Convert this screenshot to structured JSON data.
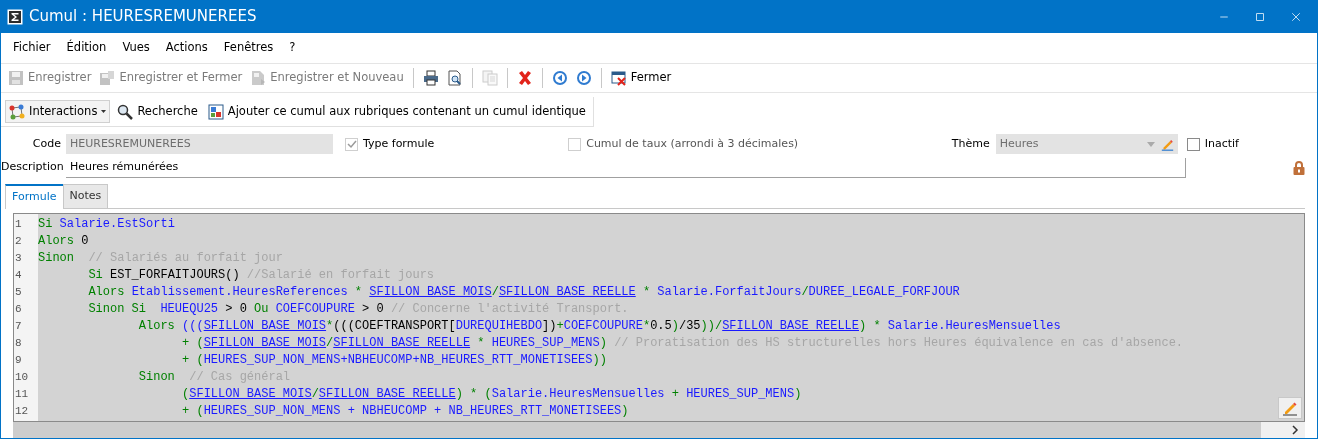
{
  "window": {
    "title": "Cumul : HEURESREMUNEREES"
  },
  "menu": [
    "Fichier",
    "Édition",
    "Vues",
    "Actions",
    "Fenêtres",
    "?"
  ],
  "toolbar": [
    {
      "kind": "button",
      "label": "Enregistrer",
      "disabled": true
    },
    {
      "kind": "button",
      "label": "Enregistrer et Fermer",
      "disabled": true
    },
    {
      "kind": "button",
      "label": "Enregistrer et Nouveau",
      "disabled": true
    },
    {
      "kind": "separator"
    },
    {
      "kind": "button",
      "disabled": false
    },
    {
      "kind": "button",
      "disabled": false
    },
    {
      "kind": "separator"
    },
    {
      "kind": "button",
      "disabled": true
    },
    {
      "kind": "separator"
    },
    {
      "kind": "button",
      "disabled": false
    },
    {
      "kind": "separator"
    },
    {
      "kind": "button",
      "disabled": false
    },
    {
      "kind": "button",
      "disabled": false
    },
    {
      "kind": "separator"
    },
    {
      "kind": "button",
      "label": "Fermer",
      "disabled": false
    }
  ],
  "toolbar2": [
    {
      "kind": "dropdown",
      "label": "Interactions"
    },
    {
      "kind": "button",
      "label": "Recherche"
    },
    {
      "kind": "button",
      "label": "Ajouter ce cumul aux rubriques contenant un cumul identique"
    }
  ],
  "form": {
    "code": {
      "label": "Code",
      "value": "HEURESREMUNEREES",
      "disabled": true
    },
    "type_formule": {
      "label": "Type formule",
      "checked": true,
      "disabled": true
    },
    "cumul_taux": {
      "label": "Cumul de taux (arrondi à 3 décimales)",
      "checked": false,
      "disabled": true
    },
    "theme": {
      "label": "Thème",
      "value": "Heures",
      "disabled": true
    },
    "inactif": {
      "label": "Inactif",
      "checked": false,
      "disabled": false
    },
    "description": {
      "label": "Description",
      "value": "Heures rémunérées"
    },
    "locked": true
  },
  "tabs": [
    {
      "label": "Formule",
      "selected": true
    },
    {
      "label": "Notes",
      "selected": false
    }
  ],
  "code_lines": [
    {
      "number": "1",
      "tokens": [
        {
          "kind": "kw",
          "text": "Si "
        },
        {
          "kind": "id",
          "text": "Salarie.EstSorti"
        }
      ]
    },
    {
      "number": "2",
      "tokens": [
        {
          "kind": "kw",
          "text": "Alors "
        },
        {
          "kind": "tx",
          "text": "0"
        }
      ]
    },
    {
      "number": "3",
      "tokens": [
        {
          "kind": "kw",
          "text": "Sinon "
        },
        {
          "kind": "cm",
          "text": " // Salariés au forfait jour"
        }
      ]
    },
    {
      "number": "4",
      "tokens": [
        {
          "kind": "kw",
          "text": "       Si "
        },
        {
          "kind": "tx",
          "text": "EST_FORFAITJOURS()"
        },
        {
          "kind": "cm",
          "text": " //Salarié en forfait jours"
        }
      ]
    },
    {
      "number": "5",
      "tokens": [
        {
          "kind": "kw",
          "text": "       Alors "
        },
        {
          "kind": "id",
          "text": "Etablissement.HeuresReferences"
        },
        {
          "kind": "op",
          "text": " * "
        },
        {
          "kind": "ln",
          "text": "SFILLON_BASE_MOIS"
        },
        {
          "kind": "op",
          "text": "/"
        },
        {
          "kind": "ln",
          "text": "SFILLON_BASE_REELLE"
        },
        {
          "kind": "op",
          "text": " * "
        },
        {
          "kind": "id",
          "text": "Salarie.ForfaitJours"
        },
        {
          "kind": "op",
          "text": "/"
        },
        {
          "kind": "id",
          "text": "DUREE_LEGALE_FORFJOUR"
        }
      ]
    },
    {
      "number": "6",
      "tokens": [
        {
          "kind": "kw",
          "text": "       Sinon Si "
        },
        {
          "kind": "id",
          "text": " HEUEQU25"
        },
        {
          "kind": "tx",
          "text": " > 0 "
        },
        {
          "kind": "kw",
          "text": "Ou "
        },
        {
          "kind": "id",
          "text": "COEFCOUPURE"
        },
        {
          "kind": "tx",
          "text": " > 0 "
        },
        {
          "kind": "cm",
          "text": "// Concerne l'activité Transport."
        }
      ]
    },
    {
      "number": "7",
      "tokens": [
        {
          "kind": "kw",
          "text": "              Alors "
        },
        {
          "kind": "id",
          "text": "((("
        },
        {
          "kind": "ln",
          "text": "SFILLON_BASE_MOIS"
        },
        {
          "kind": "op",
          "text": "*"
        },
        {
          "kind": "tx",
          "text": "(((COEFTRANSPORT["
        },
        {
          "kind": "id",
          "text": "DUREQUIHEBDO"
        },
        {
          "kind": "tx",
          "text": "])"
        },
        {
          "kind": "op",
          "text": "+"
        },
        {
          "kind": "id",
          "text": "COEFCOUPURE"
        },
        {
          "kind": "op",
          "text": "*"
        },
        {
          "kind": "tx",
          "text": "0.5"
        },
        {
          "kind": "op",
          "text": ")"
        },
        {
          "kind": "tx",
          "text": "/35"
        },
        {
          "kind": "op",
          "text": "))/"
        },
        {
          "kind": "ln",
          "text": "SFILLON_BASE_REELLE"
        },
        {
          "kind": "op",
          "text": ") * "
        },
        {
          "kind": "id",
          "text": "Salarie.HeuresMensuelles"
        }
      ]
    },
    {
      "number": "8",
      "tokens": [
        {
          "kind": "op",
          "text": "                    + ("
        },
        {
          "kind": "ln",
          "text": "SFILLON_BASE_MOIS"
        },
        {
          "kind": "op",
          "text": "/"
        },
        {
          "kind": "ln",
          "text": "SFILLON_BASE_REELLE"
        },
        {
          "kind": "op",
          "text": " * "
        },
        {
          "kind": "id",
          "text": "HEURES_SUP_MENS"
        },
        {
          "kind": "op",
          "text": ") "
        },
        {
          "kind": "cm",
          "text": "// Proratisation des HS structurelles hors Heures équivalence en cas d'absence."
        }
      ]
    },
    {
      "number": "9",
      "tokens": [
        {
          "kind": "op",
          "text": "                    + ("
        },
        {
          "kind": "id",
          "text": "HEURES_SUP_NON_MENS+NBHEUCOMP+NB_HEURES_RTT_MONETISEES"
        },
        {
          "kind": "op",
          "text": "))"
        }
      ]
    },
    {
      "number": "10",
      "tokens": [
        {
          "kind": "kw",
          "text": "              Sinon "
        },
        {
          "kind": "cm",
          "text": " // Cas général"
        }
      ]
    },
    {
      "number": "11",
      "tokens": [
        {
          "kind": "op",
          "text": "                    ("
        },
        {
          "kind": "ln",
          "text": "SFILLON_BASE_MOIS"
        },
        {
          "kind": "op",
          "text": "/"
        },
        {
          "kind": "ln",
          "text": "SFILLON_BASE_REELLE"
        },
        {
          "kind": "op",
          "text": ") * ("
        },
        {
          "kind": "id",
          "text": "Salarie.HeuresMensuelles"
        },
        {
          "kind": "op",
          "text": " + "
        },
        {
          "kind": "id",
          "text": "HEURES_SUP_MENS"
        },
        {
          "kind": "op",
          "text": ")"
        }
      ]
    },
    {
      "number": "12",
      "tokens": [
        {
          "kind": "op",
          "text": "                    + ("
        },
        {
          "kind": "id",
          "text": "HEURES_SUP_NON_MENS + NBHEUCOMP + NB_HEURES_RTT_MONETISEES"
        },
        {
          "kind": "op",
          "text": ")"
        }
      ]
    }
  ]
}
